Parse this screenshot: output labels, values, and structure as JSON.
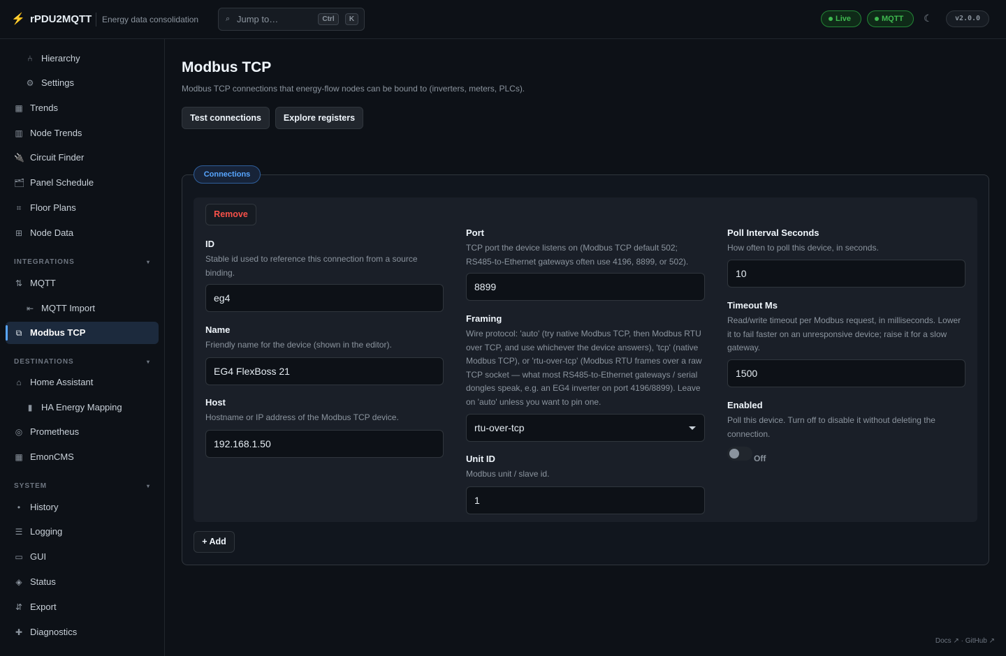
{
  "header": {
    "logo_glyph": "⚡",
    "app_name": "rPDU2MQTT",
    "subtitle": "Energy data consolidation",
    "search_placeholder": "Jump to…",
    "shortcut_ctrl": "Ctrl",
    "shortcut_key": "K",
    "status_live": "Live",
    "status_mqtt": "MQTT",
    "theme_icon": "moon-icon",
    "version": "v2.0.0",
    "status_color": "#3fb950"
  },
  "sidebar": {
    "items": [
      {
        "label": "Hierarchy",
        "icon": "hierarchy-icon",
        "glyph": "⑃"
      },
      {
        "label": "Settings",
        "icon": "gear-icon",
        "glyph": "⚙"
      },
      {
        "label": "Trends",
        "icon": "trends-icon",
        "glyph": "▦"
      },
      {
        "label": "Node Trends",
        "icon": "node-trends-icon",
        "glyph": "▥"
      },
      {
        "label": "Circuit Finder",
        "icon": "plug-icon",
        "glyph": "🔌"
      },
      {
        "label": "Panel Schedule",
        "icon": "panel-icon",
        "glyph": "🗂"
      },
      {
        "label": "Floor Plans",
        "icon": "floorplan-icon",
        "glyph": "⌗"
      },
      {
        "label": "Node Data",
        "icon": "grid-icon",
        "glyph": "⊞"
      }
    ],
    "integrations_header": "INTEGRATIONS",
    "integrations": [
      {
        "label": "MQTT",
        "icon": "arrows-icon",
        "glyph": "⇅"
      },
      {
        "label": "MQTT Import",
        "icon": "import-icon",
        "glyph": "⇤"
      },
      {
        "label": "Modbus TCP",
        "icon": "modbus-icon",
        "glyph": "⧉"
      }
    ],
    "destinations_header": "DESTINATIONS",
    "destinations": [
      {
        "label": "Home Assistant",
        "icon": "home-icon",
        "glyph": "⌂"
      },
      {
        "label": "HA Energy Mapping",
        "icon": "bar-icon",
        "glyph": "▮"
      },
      {
        "label": "Prometheus",
        "icon": "target-icon",
        "glyph": "◎"
      },
      {
        "label": "EmonCMS",
        "icon": "chart-icon",
        "glyph": "▦"
      }
    ],
    "system_header": "SYSTEM",
    "system": [
      {
        "label": "History",
        "icon": "dot-icon",
        "glyph": "•"
      },
      {
        "label": "Logging",
        "icon": "list-icon",
        "glyph": "☰"
      },
      {
        "label": "GUI",
        "icon": "window-icon",
        "glyph": "▭"
      },
      {
        "label": "Status",
        "icon": "diamond-icon",
        "glyph": "◈"
      },
      {
        "label": "Export",
        "icon": "export-icon",
        "glyph": "⇵"
      },
      {
        "label": "Diagnostics",
        "icon": "plus-icon",
        "glyph": "✚"
      }
    ],
    "collapse_glyph": "▾",
    "accent_color": "#58a6ff"
  },
  "main": {
    "title": "Modbus TCP",
    "description": "Modbus TCP connections that energy-flow nodes can be bound to (inverters, meters, PLCs).",
    "test_button": "Test connections",
    "explore_button": "Explore registers",
    "section_tab": "Connections",
    "remove_button": "Remove",
    "add_button": "+ Add",
    "fields": {
      "id": {
        "label": "ID",
        "help": "Stable id used to reference this connection from a source binding.",
        "value": "eg4"
      },
      "name": {
        "label": "Name",
        "help": "Friendly name for the device (shown in the editor).",
        "value": "EG4 FlexBoss 21"
      },
      "host": {
        "label": "Host",
        "help": "Hostname or IP address of the Modbus TCP device.",
        "value": "192.168.1.50"
      },
      "port": {
        "label": "Port",
        "help": "TCP port the device listens on (Modbus TCP default 502; RS485-to-Ethernet gateways often use 4196, 8899, or 502).",
        "value": "8899"
      },
      "framing": {
        "label": "Framing",
        "help": "Wire protocol: 'auto' (try native Modbus TCP, then Modbus RTU over TCP, and use whichever the device answers), 'tcp' (native Modbus TCP), or 'rtu-over-tcp' (Modbus RTU frames over a raw TCP socket — what most RS485-to-Ethernet gateways / serial dongles speak, e.g. an EG4 inverter on port 4196/8899). Leave on 'auto' unless you want to pin one.",
        "value": "rtu-over-tcp"
      },
      "unit_id": {
        "label": "Unit ID",
        "help": "Modbus unit / slave id.",
        "value": "1"
      },
      "poll": {
        "label": "Poll Interval Seconds",
        "help": "How often to poll this device, in seconds.",
        "value": "10"
      },
      "timeout": {
        "label": "Timeout Ms",
        "help": "Read/write timeout per Modbus request, in milliseconds. Lower it to fail faster on an unresponsive device; raise it for a slow gateway.",
        "value": "1500"
      },
      "enabled": {
        "label": "Enabled",
        "help": "Poll this device. Turn off to disable it without deleting the connection.",
        "state_label": "Off"
      }
    },
    "danger_color": "#f85149"
  },
  "footer": {
    "links": "Docs ↗ · GitHub ↗"
  }
}
